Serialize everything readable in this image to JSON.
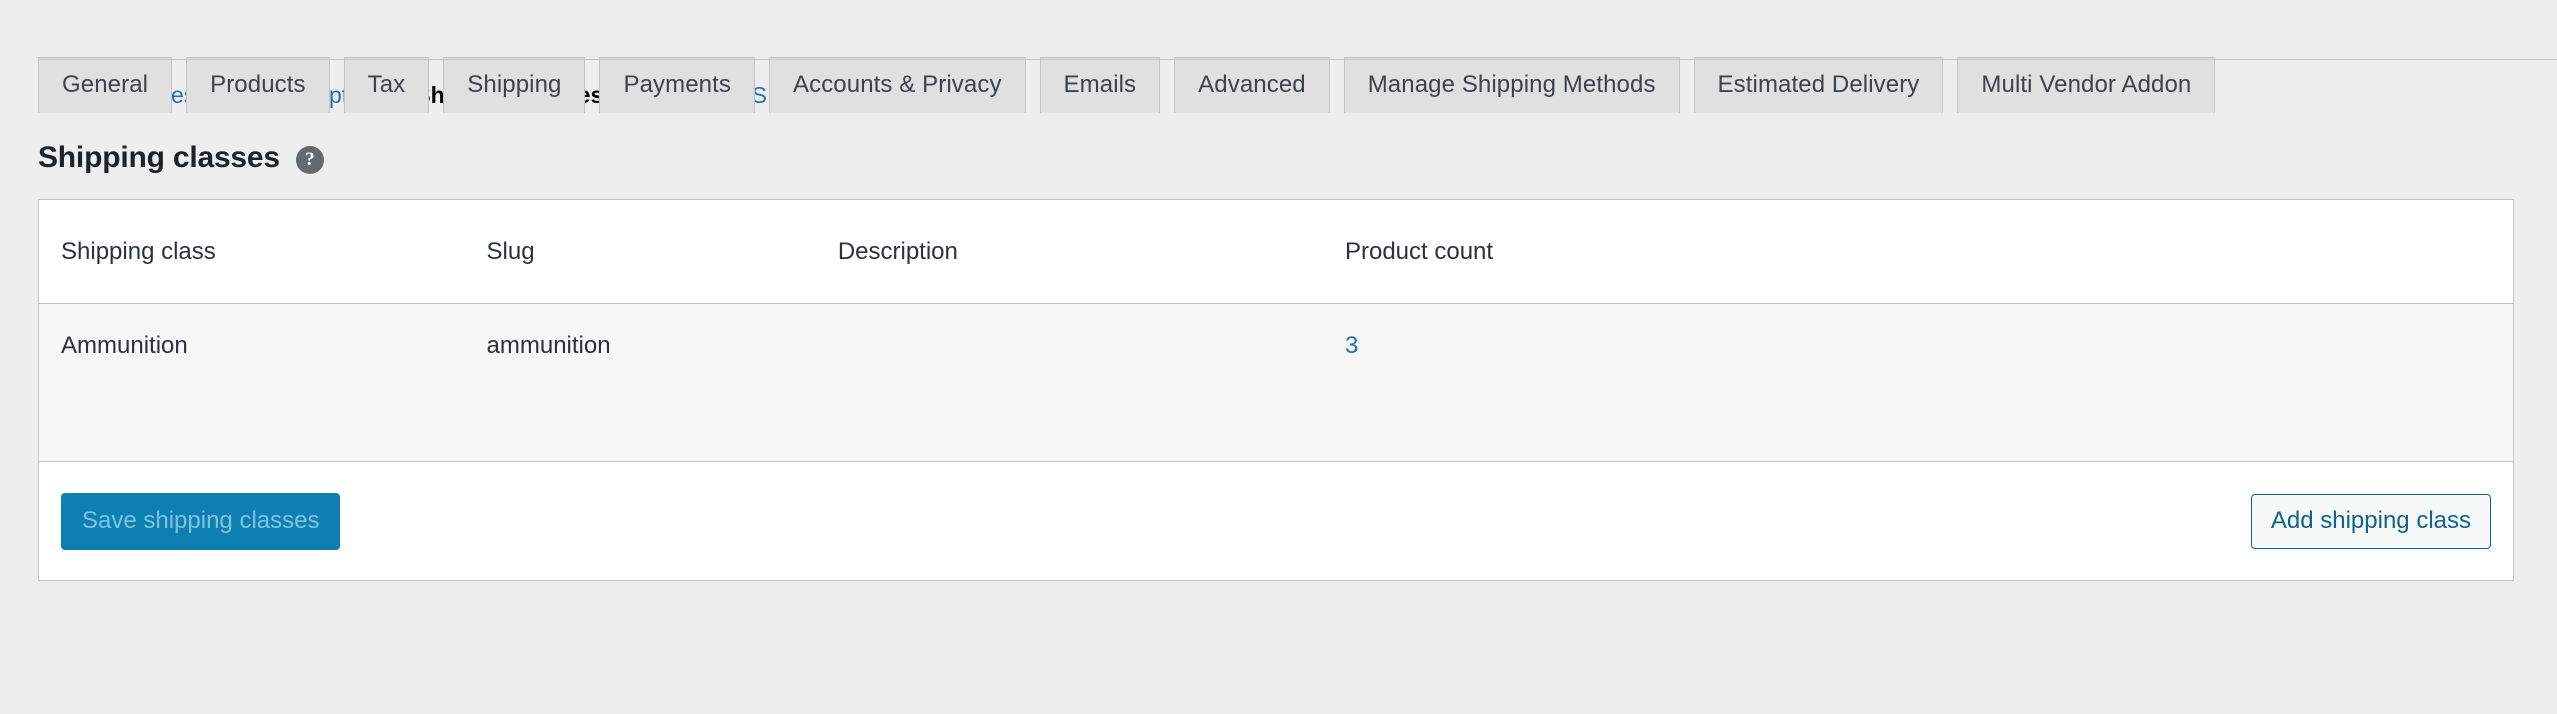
{
  "tabs": [
    {
      "label": "General",
      "active": false
    },
    {
      "label": "Products",
      "active": false
    },
    {
      "label": "Tax",
      "active": false
    },
    {
      "label": "Shipping",
      "active": false
    },
    {
      "label": "Payments",
      "active": false
    },
    {
      "label": "Accounts & Privacy",
      "active": false
    },
    {
      "label": "Emails",
      "active": false
    },
    {
      "label": "Advanced",
      "active": false
    },
    {
      "label": "Manage Shipping Methods",
      "active": false
    },
    {
      "label": "Estimated Delivery",
      "active": false
    },
    {
      "label": "Multi Vendor Addon",
      "active": false
    }
  ],
  "subnav": {
    "items": [
      {
        "label": "Shipping zones",
        "current": false
      },
      {
        "label": "Shipping options",
        "current": false
      },
      {
        "label": "Shipping classes",
        "current": true
      },
      {
        "label": "FedEx",
        "current": false
      },
      {
        "label": "UPS",
        "current": false
      },
      {
        "label": "Dokan Shipping",
        "current": false
      }
    ],
    "separator": "|"
  },
  "heading": {
    "title": "Shipping classes",
    "help_icon_glyph": "?"
  },
  "table": {
    "columns": [
      "Shipping class",
      "Slug",
      "Description",
      "Product count"
    ],
    "rows": [
      {
        "shipping_class": "Ammunition",
        "slug": "ammunition",
        "description": "",
        "product_count": "3"
      }
    ]
  },
  "footer": {
    "save_label": "Save shipping classes",
    "add_label": "Add shipping class"
  },
  "colors": {
    "page_background": "#eeeeee",
    "link": "#2271b1",
    "primary_button": "#0d7fb0",
    "primary_button_text": "#7fc2e0",
    "secondary_button_border": "#0d6896",
    "tab_background": "#e0e0e0",
    "table_border": "#c3c4c7",
    "row_background": "#f6f7f7"
  }
}
